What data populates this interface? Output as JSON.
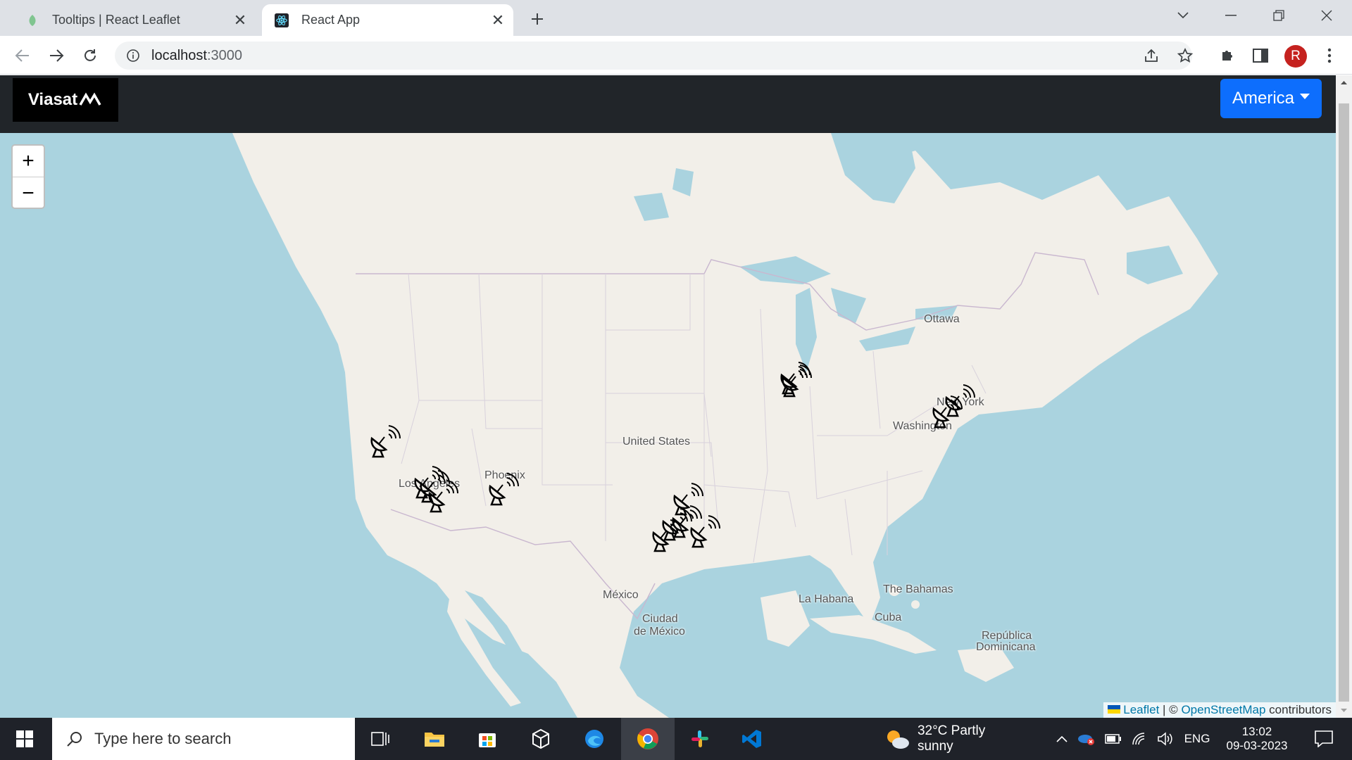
{
  "browser": {
    "tabs": [
      {
        "title": "Tooltips | React Leaflet",
        "favicon": "leaf-icon",
        "active": false
      },
      {
        "title": "React App",
        "favicon": "react-icon",
        "active": true
      }
    ],
    "url_host": "localhost",
    "url_port": ":3000",
    "profile_initial": "R"
  },
  "app": {
    "logo_text": "Viasat",
    "region_button": "America"
  },
  "map": {
    "zoom_in": "+",
    "zoom_out": "−",
    "labels": {
      "ottawa": "Ottawa",
      "new_york": "New York",
      "washington": "Washington",
      "united_states": "United States",
      "los_angeles": "Los Angeles",
      "phoenix": "Phoenix",
      "mexico": "México",
      "ciudad": "Ciudad",
      "de_mexico": "de México",
      "la_habana": "La Habana",
      "bahamas": "The Bahamas",
      "cuba": "Cuba",
      "republica": "República",
      "dominicana": "Dominicana"
    },
    "attribution": {
      "leaflet": "Leaflet",
      "separator": " | © ",
      "osm": "OpenStreetMap",
      "suffix": " contributors"
    },
    "marker_icon": "satellite-dish-icon",
    "marker_count": 14
  },
  "taskbar": {
    "search_placeholder": "Type here to search",
    "weather": "32°C  Partly sunny",
    "language": "ENG",
    "time": "13:02",
    "date": "09-03-2023"
  }
}
